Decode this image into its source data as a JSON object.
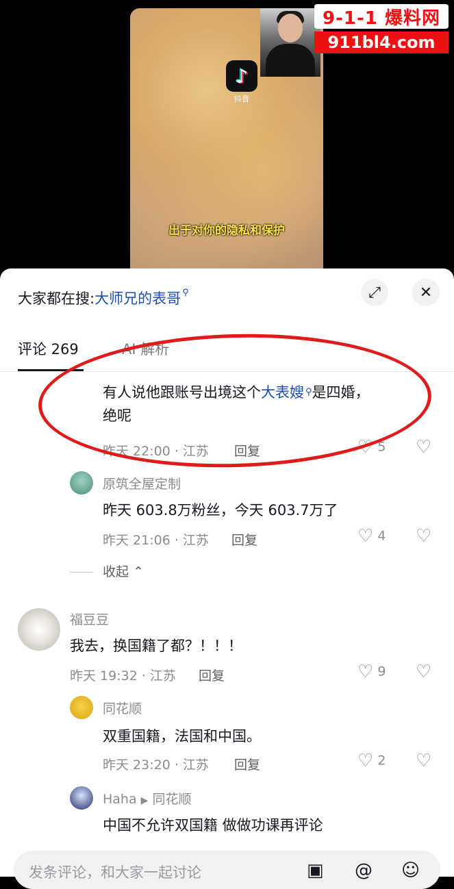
{
  "video": {
    "app_icon_label": "抖音",
    "subtitle": "出于对你的隐私和保护",
    "watermark_top": "9-1-1 爆料网",
    "watermark_bottom": "911bl4.com"
  },
  "header": {
    "search_prefix": "大家都在搜:",
    "search_term": "大师兄的表哥",
    "expand_icon": "expand-icon",
    "close_icon": "close-icon"
  },
  "tabs": [
    {
      "label": "评论 269",
      "active": true
    },
    {
      "label": "AI 解析",
      "active": false
    }
  ],
  "comments": [
    {
      "text_before": "有人说他跟账号出境这个",
      "link": "大表嫂",
      "text_after": "是四婚，",
      "text_line2": "绝呢",
      "meta": "昨天 22:00 · 江苏",
      "reply": "回复",
      "likes": "5"
    },
    {
      "username": "原筑全屋定制",
      "text": "昨天 603.8万粉丝，今天 603.7万了",
      "meta": "昨天 21:06 · 江苏",
      "reply": "回复",
      "likes": "4"
    },
    {
      "username": "福豆豆",
      "text": "我去，换国籍了都？！！！",
      "meta": "昨天 19:32 · 江苏",
      "reply": "回复",
      "likes": "9"
    },
    {
      "username": "同花顺",
      "text": "双重国籍，法国和中国。",
      "meta": "昨天 23:20 · 江苏",
      "reply": "回复",
      "likes": "2"
    },
    {
      "username": "Haha",
      "reply_to": "同花顺",
      "text": "中国不允许双国籍 做做功课再评论"
    }
  ],
  "collapse_label": "收起",
  "input": {
    "placeholder": "发条评论，和大家一起讨论"
  },
  "colors": {
    "link": "#1e4db7",
    "annotation": "#e11a1a",
    "watermark": "#e11111"
  }
}
